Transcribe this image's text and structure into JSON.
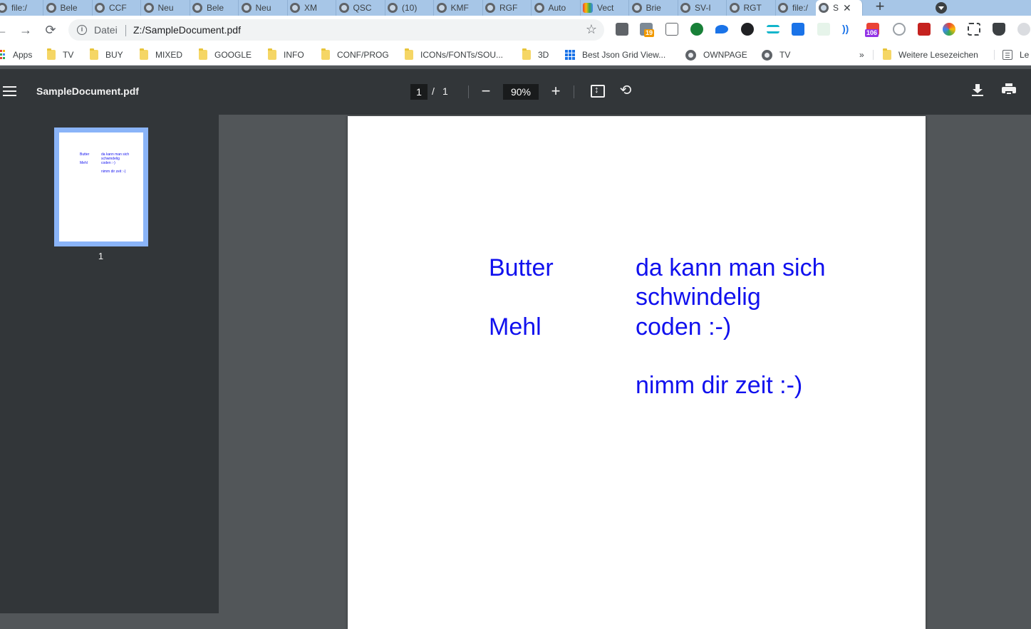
{
  "tabs": [
    {
      "label": "file:/",
      "icon": "globe-icon"
    },
    {
      "label": "Bele",
      "icon": "globe-icon"
    },
    {
      "label": "CCF",
      "icon": "globe-icon"
    },
    {
      "label": "Neu",
      "icon": "globe-icon"
    },
    {
      "label": "Bele",
      "icon": "globe-icon"
    },
    {
      "label": "Neu",
      "icon": "globe-icon"
    },
    {
      "label": "XM",
      "icon": "globe-icon"
    },
    {
      "label": "QSC",
      "icon": "globe-icon"
    },
    {
      "label": "(10)",
      "icon": "globe-icon"
    },
    {
      "label": "KMF",
      "icon": "globe-icon"
    },
    {
      "label": "RGF",
      "icon": "globe-icon"
    },
    {
      "label": "Auto",
      "icon": "globe-icon"
    },
    {
      "label": "Vect",
      "icon": "rainbow-icon"
    },
    {
      "label": "Brie",
      "icon": "globe-icon"
    },
    {
      "label": "SV-I",
      "icon": "globe-icon"
    },
    {
      "label": "RGT",
      "icon": "globe-icon"
    },
    {
      "label": "file:/",
      "icon": "globe-icon"
    },
    {
      "label": "S",
      "icon": "globe-icon",
      "active": true
    }
  ],
  "tab_close": "✕",
  "new_tab": "+",
  "omnibox": {
    "scheme_label": "Datei",
    "url": "Z:/SampleDocument.pdf"
  },
  "extensions": {
    "calendar_badge": "19",
    "mail_badge": "106"
  },
  "bookmarks": [
    {
      "label": "Apps",
      "icon": "apps-icon"
    },
    {
      "label": "TV",
      "icon": "folder-icon"
    },
    {
      "label": "BUY",
      "icon": "folder-icon"
    },
    {
      "label": "MIXED",
      "icon": "folder-icon"
    },
    {
      "label": "GOOGLE",
      "icon": "folder-icon"
    },
    {
      "label": "INFO",
      "icon": "folder-icon"
    },
    {
      "label": "CONF/PROG",
      "icon": "folder-icon"
    },
    {
      "label": "ICONs/FONTs/SOU...",
      "icon": "folder-icon"
    },
    {
      "label": "3D",
      "icon": "folder-icon"
    },
    {
      "label": "Best Json Grid View...",
      "icon": "grid-icon"
    },
    {
      "label": "OWNPAGE",
      "icon": "globe-icon"
    },
    {
      "label": "TV",
      "icon": "globe-icon"
    }
  ],
  "bookmarks_overflow": "»",
  "other_bookmarks": "Weitere Lesezeichen",
  "reading_list": "Le",
  "pdf_viewer": {
    "title": "SampleDocument.pdf",
    "current_page": "1",
    "page_separator": "/",
    "total_pages": "1",
    "zoom": "90%",
    "zoom_out": "−",
    "zoom_in": "+",
    "rotate": "⟲"
  },
  "thumbnail": {
    "page_number": "1"
  },
  "document": {
    "text_color": "#1111ee",
    "label_1": "Butter",
    "label_2": "Mehl",
    "line_1": "da kann man sich",
    "line_2": "schwindelig",
    "line_3": "coden :-)",
    "line_4": "nimm dir zeit :-)"
  },
  "colors": {
    "tabstrip": "#a7c6e7",
    "pdf_toolbar": "#323639",
    "viewport_bg": "#525659",
    "thumbnail_highlight": "#8ab4f8"
  }
}
